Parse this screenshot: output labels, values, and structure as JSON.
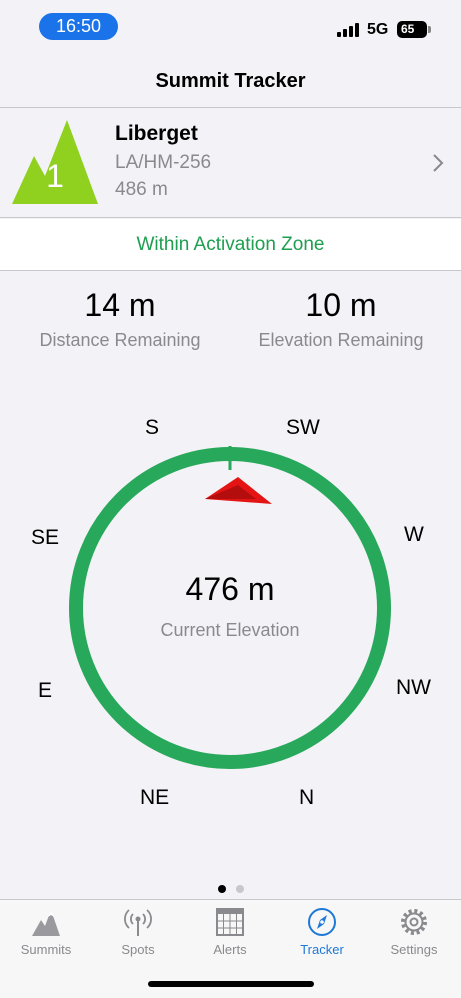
{
  "status": {
    "time": "16:50",
    "network": "5G",
    "battery": "65"
  },
  "nav": {
    "title": "Summit Tracker"
  },
  "summit": {
    "points": "1",
    "name": "Liberget",
    "reference": "LA/HM-256",
    "altitude": "486 m"
  },
  "zone": {
    "status": "Within Activation Zone"
  },
  "stats": {
    "distance": {
      "value": "14 m",
      "label": "Distance Remaining"
    },
    "elevation": {
      "value": "10 m",
      "label": "Elevation Remaining"
    }
  },
  "compass": {
    "labels": {
      "s": "S",
      "sw": "SW",
      "w": "W",
      "nw": "NW",
      "n": "N",
      "ne": "NE",
      "e": "E",
      "se": "SE"
    },
    "current_elevation": "476 m",
    "current_elevation_label": "Current Elevation",
    "ring_color": "#27a85a",
    "pointer_color": "#e51414"
  },
  "pager": {
    "pages": 2,
    "active": 1
  },
  "tabs": [
    {
      "label": "Summits",
      "icon": "mountain-icon",
      "active": false
    },
    {
      "label": "Spots",
      "icon": "antenna-icon",
      "active": false
    },
    {
      "label": "Alerts",
      "icon": "calendar-icon",
      "active": false
    },
    {
      "label": "Tracker",
      "icon": "compass-icon",
      "active": true
    },
    {
      "label": "Settings",
      "icon": "gear-icon",
      "active": false
    }
  ],
  "colors": {
    "accent": "#1e78d6",
    "zone_green": "#1e9e50",
    "mountain_green": "#8fd11e"
  }
}
